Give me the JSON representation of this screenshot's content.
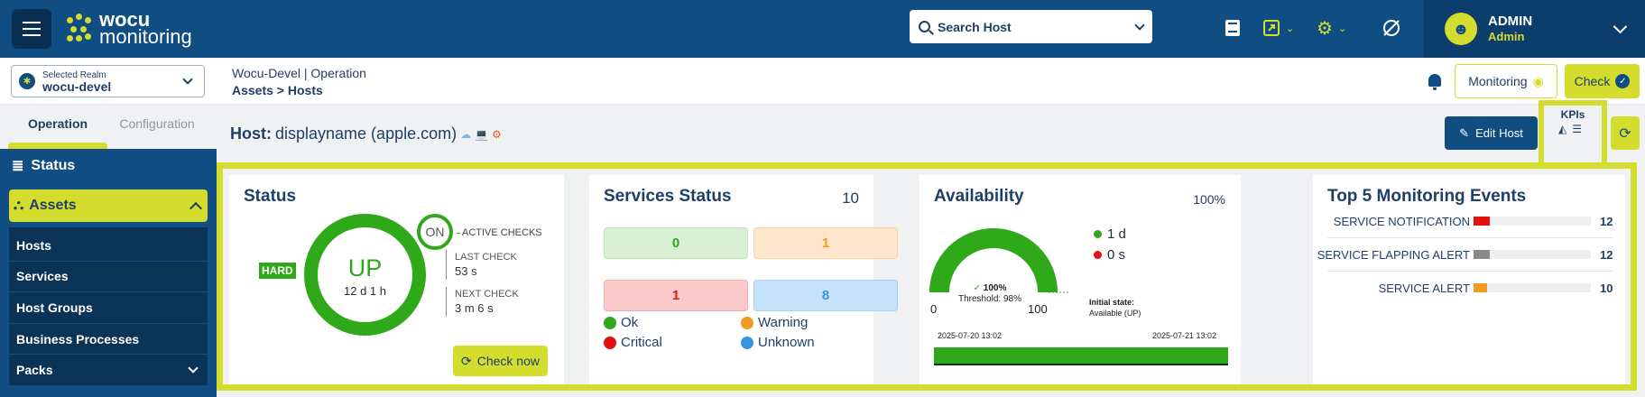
{
  "brand": {
    "line1": "wocu",
    "line2": "monitoring",
    "accent": "#d4dc2e",
    "primary": "#0f4d82"
  },
  "search": {
    "placeholder": "Search Host",
    "icon": "search-icon"
  },
  "header_icons": [
    "book-icon",
    "external-link-icon",
    "gears-icon",
    "satellite-off-icon"
  ],
  "user": {
    "name": "ADMIN",
    "role": "Admin"
  },
  "realm": {
    "label": "Selected Realm",
    "value": "wocu-devel"
  },
  "breadcrumb": {
    "line1": "Wocu-Devel | Operation",
    "line2": "Assets > Hosts"
  },
  "toolbar": {
    "monitoring": "Monitoring",
    "check": "Check"
  },
  "sidebar": {
    "tabs": [
      {
        "label": "Operation"
      },
      {
        "label": "Configuration"
      }
    ],
    "status": "Status",
    "assets": "Assets",
    "items": [
      {
        "label": "Hosts"
      },
      {
        "label": "Services"
      },
      {
        "label": "Host Groups"
      },
      {
        "label": "Business Processes"
      },
      {
        "label": "Packs"
      }
    ]
  },
  "host": {
    "prefix": "Host:",
    "name": "displayname (apple.com)"
  },
  "actions": {
    "edit": "Edit Host",
    "kpis": "KPIs"
  },
  "status_card": {
    "title": "Status",
    "state": "UP",
    "duration": "12 d 1 h",
    "type": "HARD",
    "active_checks_state": "ON",
    "active_checks_label": "ACTIVE CHECKS",
    "last_check_label": "LAST CHECK",
    "last_check_value": "53 s",
    "next_check_label": "NEXT CHECK",
    "next_check_value": "3 m 6 s",
    "check_now": "Check now"
  },
  "services_card": {
    "title": "Services Status",
    "total": "10",
    "counts": {
      "ok": "0",
      "warning": "1",
      "critical": "1",
      "unknown": "8"
    },
    "legend": {
      "ok": "Ok",
      "warning": "Warning",
      "critical": "Critical",
      "unknown": "Unknown"
    },
    "colors": {
      "ok": "#2fa81a",
      "warning": "#f29a21",
      "critical": "#e41111",
      "unknown": "#3a94e4"
    }
  },
  "availability_card": {
    "title": "Availability",
    "percent": "100%",
    "gauge_fraction": 1.0,
    "gauge_value": "100%",
    "threshold": "Threshold: 98%",
    "min": "0",
    "max": "100",
    "up_time": "1 d",
    "down_time": "0 s",
    "initial_label": "Initial state:",
    "initial_value": "Available (UP)",
    "start": "2025-07-20 13:02",
    "end": "2025-07-21 13:02"
  },
  "events_card": {
    "title": "Top 5 Monitoring Events",
    "max": 12,
    "events": [
      {
        "name": "SERVICE NOTIFICATION",
        "count": "12",
        "value": 12,
        "color": "#e41111"
      },
      {
        "name": "SERVICE FLAPPING ALERT",
        "count": "12",
        "value": 12,
        "color": "#8a8a8a"
      },
      {
        "name": "SERVICE ALERT",
        "count": "10",
        "value": 10,
        "color": "#f29a21"
      }
    ]
  }
}
